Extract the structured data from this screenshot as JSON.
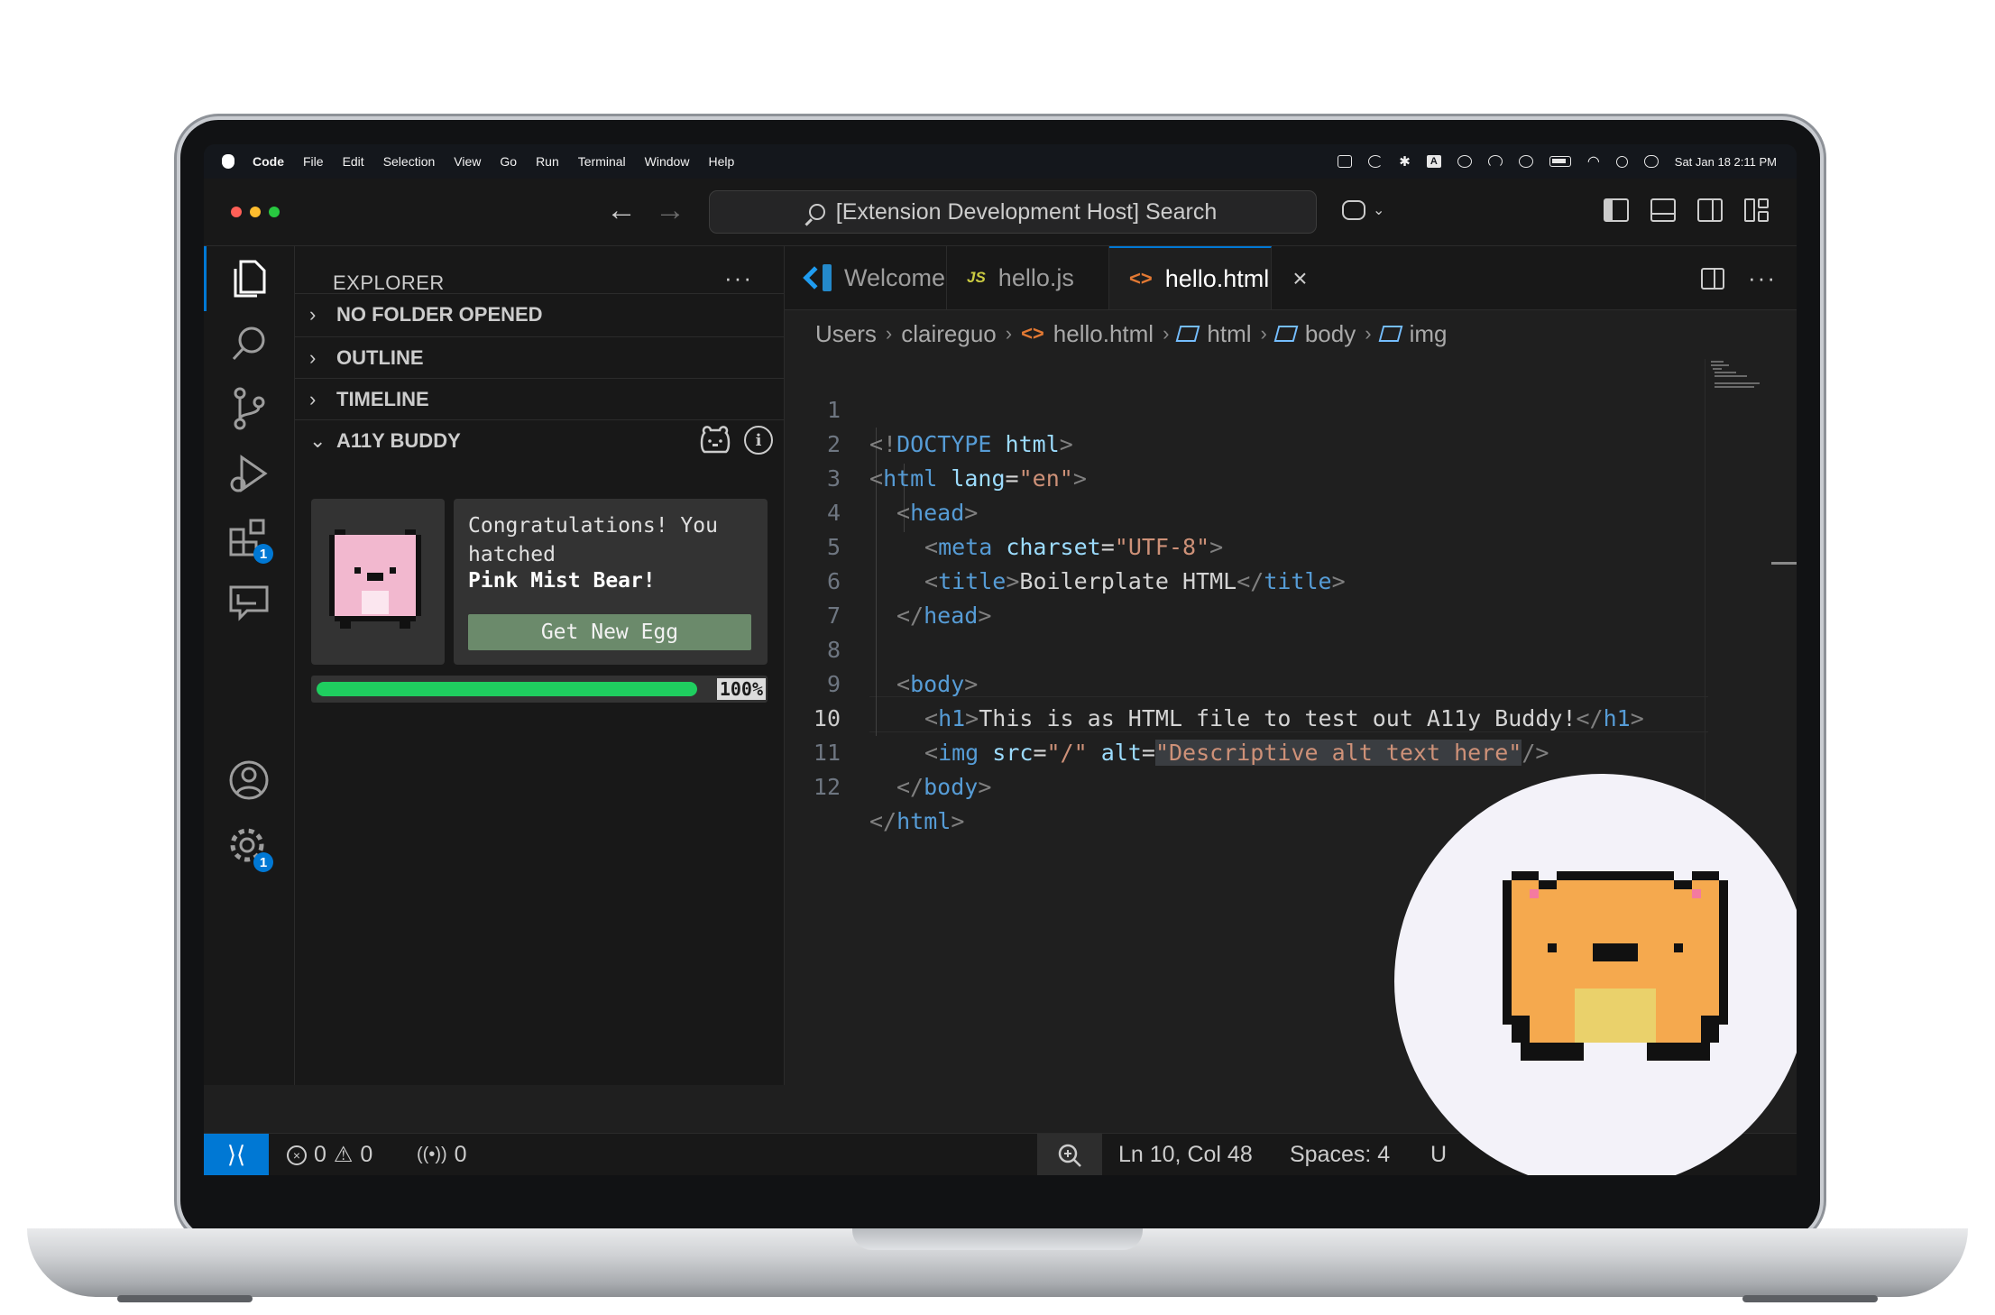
{
  "menubar": {
    "app": "Code",
    "items": [
      "File",
      "Edit",
      "Selection",
      "View",
      "Go",
      "Run",
      "Terminal",
      "Window",
      "Help"
    ],
    "keyboard_indicator": "A",
    "clock": "Sat Jan 18  2:11 PM"
  },
  "titlebar": {
    "command_center": "[Extension Development Host] Search"
  },
  "activity_bar": {
    "extensions_badge": "1",
    "settings_badge": "1"
  },
  "sidebar": {
    "title": "EXPLORER",
    "more": "···",
    "sections": {
      "no_folder": "NO FOLDER OPENED",
      "outline": "OUTLINE",
      "timeline": "TIMELINE",
      "a11y": "A11Y BUDDY"
    },
    "buddy": {
      "message": "Congratulations! You hatched",
      "name": "Pink Mist Bear!",
      "button": "Get New Egg",
      "progress_value": 1.0,
      "progress_label": "100%"
    }
  },
  "tabs": [
    {
      "label": "Welcome"
    },
    {
      "label": "hello.js",
      "icon": "JS"
    },
    {
      "label": "hello.html",
      "icon": "<>"
    }
  ],
  "breadcrumb": [
    "Users",
    "claireguo",
    "hello.html",
    "html",
    "body",
    "img"
  ],
  "code": {
    "line_numbers": [
      "1",
      "2",
      "3",
      "4",
      "5",
      "6",
      "7",
      "8",
      "9",
      "10",
      "11",
      "12"
    ],
    "l1": {
      "a": "<!",
      "b": "DOCTYPE",
      "c": " html",
      "d": ">"
    },
    "l2": {
      "a": "<",
      "b": "html",
      "c": " lang",
      "d": "=",
      "e": "\"en\"",
      "f": ">"
    },
    "l3": {
      "a": "<",
      "b": "head",
      "c": ">"
    },
    "l4": {
      "a": "<",
      "b": "meta",
      "c": " charset",
      "d": "=",
      "e": "\"UTF-8\"",
      "f": ">"
    },
    "l5": {
      "a": "<",
      "b": "title",
      "c": ">",
      "d": "Boilerplate HTML",
      "e": "</",
      "f": "title",
      "g": ">"
    },
    "l6": {
      "a": "</",
      "b": "head",
      "c": ">"
    },
    "l8": {
      "a": "<",
      "b": "body",
      "c": ">"
    },
    "l9": {
      "a": "<",
      "b": "h1",
      "c": ">",
      "d": "This is as HTML file to test out A11y Buddy!",
      "e": "</",
      "f": "h1",
      "g": ">"
    },
    "l10": {
      "a": "<",
      "b": "img",
      "c": " src",
      "d": "=",
      "e": "\"/\"",
      "f": " alt",
      "g": "=",
      "h": "\"Descriptive alt text here\"",
      "i": "/>"
    },
    "l11": {
      "a": "</",
      "b": "body",
      "c": ">"
    },
    "l12": {
      "a": "</",
      "b": "html",
      "c": ">"
    }
  },
  "statusbar": {
    "errors": "0",
    "warnings": "0",
    "ports": "0",
    "cursor": "Ln 10, Col 48",
    "spaces": "Spaces: 4",
    "encoding_partial": "U"
  },
  "colors": {
    "accent": "#0078d4",
    "progress": "#1fce5f",
    "pink_bear": "#f2b8cf",
    "orange_bear": "#f5a94e"
  }
}
